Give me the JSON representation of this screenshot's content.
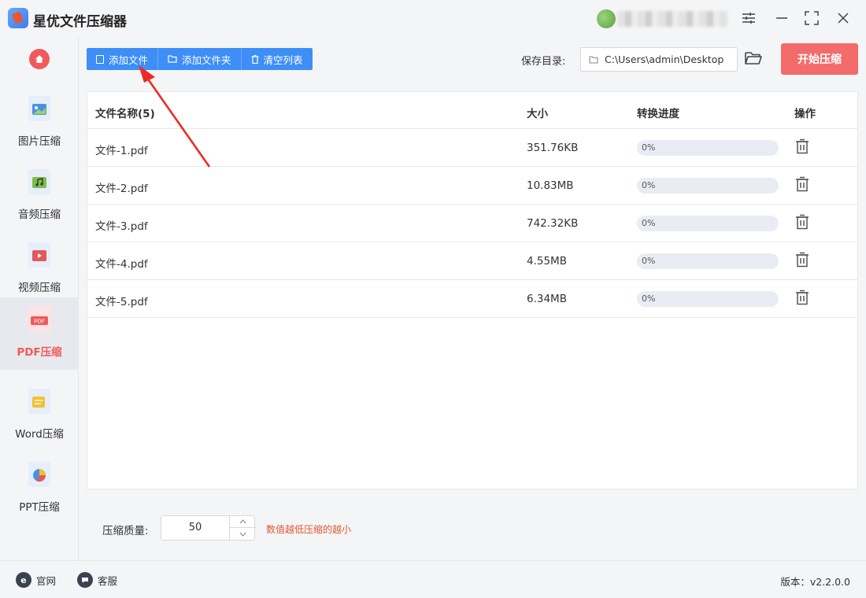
{
  "app": {
    "title": "星优文件压缩器"
  },
  "sidebar": {
    "items": [
      {
        "label": "图片压缩",
        "icon": "image-file-icon",
        "color": "#4a90e2"
      },
      {
        "label": "音频压缩",
        "icon": "audio-file-icon",
        "color": "#7bbf4a"
      },
      {
        "label": "视频压缩",
        "icon": "video-file-icon",
        "color": "#e05a5a"
      },
      {
        "label": "PDF压缩",
        "icon": "pdf-file-icon",
        "color": "#f05a5a",
        "active": true
      },
      {
        "label": "Word压缩",
        "icon": "word-file-icon",
        "color": "#f2c230"
      },
      {
        "label": "PPT压缩",
        "icon": "ppt-file-icon",
        "color": "#e8734a"
      }
    ]
  },
  "toolbar": {
    "add_file": "添加文件",
    "add_folder": "添加文件夹",
    "clear_list": "清空列表",
    "save_label": "保存目录:",
    "save_path": "C:\\Users\\admin\\Desktop",
    "start": "开始压缩"
  },
  "table": {
    "headers": {
      "name": "文件名称(5)",
      "size": "大小",
      "progress": "转换进度",
      "action": "操作"
    },
    "rows": [
      {
        "name": "文件-1.pdf",
        "size": "351.76KB",
        "progress": 0,
        "progress_text": "0%"
      },
      {
        "name": "文件-2.pdf",
        "size": "10.83MB",
        "progress": 0,
        "progress_text": "0%"
      },
      {
        "name": "文件-3.pdf",
        "size": "742.32KB",
        "progress": 0,
        "progress_text": "0%"
      },
      {
        "name": "文件-4.pdf",
        "size": "4.55MB",
        "progress": 0,
        "progress_text": "0%"
      },
      {
        "name": "文件-5.pdf",
        "size": "6.34MB",
        "progress": 0,
        "progress_text": "0%"
      }
    ]
  },
  "quality": {
    "label": "压缩质量:",
    "value": "50",
    "hint": "数值越低压缩的越小"
  },
  "footer": {
    "website": "官网",
    "service": "客服",
    "version": "版本：v2.2.0.0"
  },
  "colors": {
    "primary": "#3d8ef7",
    "accent": "#f36b6b",
    "hint": "#e0582d"
  }
}
